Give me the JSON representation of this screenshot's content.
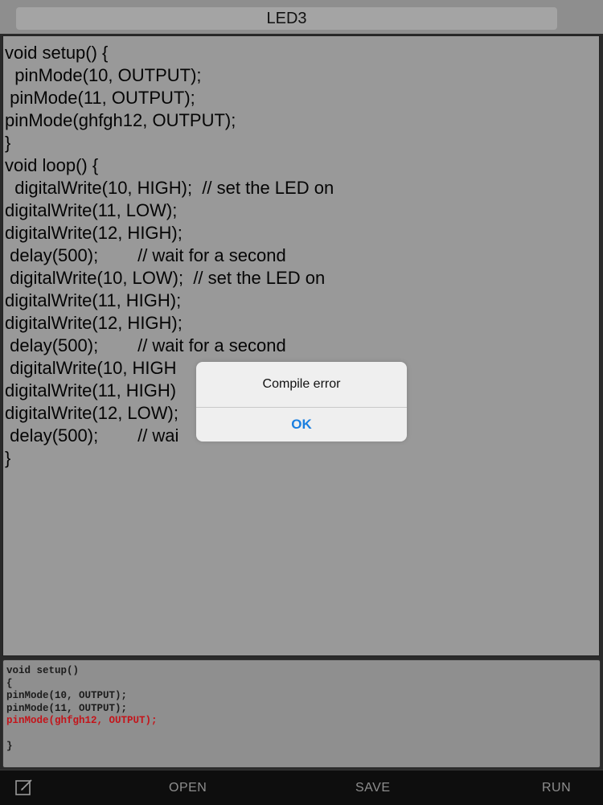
{
  "app": {
    "title": "LED3"
  },
  "editor": {
    "lines": [
      "void setup() {",
      "  pinMode(10, OUTPUT);",
      " pinMode(11, OUTPUT);",
      "pinMode(ghfgh12, OUTPUT);",
      "}",
      "void loop() {",
      "  digitalWrite(10, HIGH);  // set the LED on",
      "digitalWrite(11, LOW);",
      "digitalWrite(12, HIGH);",
      " delay(500);        // wait for a second",
      " digitalWrite(10, LOW);  // set the LED on",
      "digitalWrite(11, HIGH);",
      "digitalWrite(12, HIGH);",
      " delay(500);        // wait for a second",
      " digitalWrite(10, HIGH",
      "digitalWrite(11, HIGH)",
      "digitalWrite(12, LOW);",
      " delay(500);        // wai",
      "}"
    ]
  },
  "console": {
    "lines": [
      {
        "text": "void setup()",
        "error": false
      },
      {
        "text": "{",
        "error": false
      },
      {
        "text": "pinMode(10, OUTPUT);",
        "error": false
      },
      {
        "text": "pinMode(11, OUTPUT);",
        "error": false
      },
      {
        "text": "pinMode(ghfgh12, OUTPUT);",
        "error": true
      },
      {
        "text": "",
        "error": false
      },
      {
        "text": "}",
        "error": false
      }
    ],
    "error_color": "#c4141a"
  },
  "toolbar": {
    "compose_icon": "compose-icon",
    "open_label": "OPEN",
    "save_label": "SAVE",
    "run_label": "RUN"
  },
  "alert": {
    "title": "Compile error",
    "ok_label": "OK",
    "ok_color": "#1a7fe0"
  }
}
